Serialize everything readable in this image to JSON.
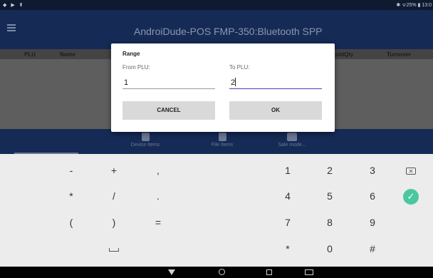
{
  "statusbar": {
    "left_icons": "◆ ▶ ⬆",
    "right": "✱ ᯤ25% ▮ 13:0"
  },
  "appbar": {
    "title": "AndroiDude-POS",
    "subtitle": "FMP-350:Bluetooth SPP"
  },
  "table_header": {
    "col_plu": "PLU",
    "col_name": "Name",
    "col_soldqty": "oldQty",
    "col_turnover": "Turnover"
  },
  "bottomnav": {
    "items": [
      {
        "label": "Device Items",
        "icon": "database-icon"
      },
      {
        "label": "File Items",
        "icon": "file-icon"
      },
      {
        "label": "Sale mode...",
        "icon": "register-icon"
      }
    ]
  },
  "dialog": {
    "title": "Range",
    "from_label": "From PLU:",
    "from_value": "1",
    "to_label": "To PLU:",
    "to_value": "2",
    "cancel_label": "CANCEL",
    "ok_label": "OK"
  },
  "keyboard": {
    "row1": [
      "-",
      "+",
      ",",
      "1",
      "2",
      "3"
    ],
    "row2": [
      "*",
      "/",
      ".",
      "4",
      "5",
      "6"
    ],
    "row3": [
      "(",
      ")",
      "=",
      "7",
      "8",
      "9"
    ],
    "row4": [
      "*",
      "0",
      "#"
    ],
    "accent": "#4bc7a0"
  }
}
